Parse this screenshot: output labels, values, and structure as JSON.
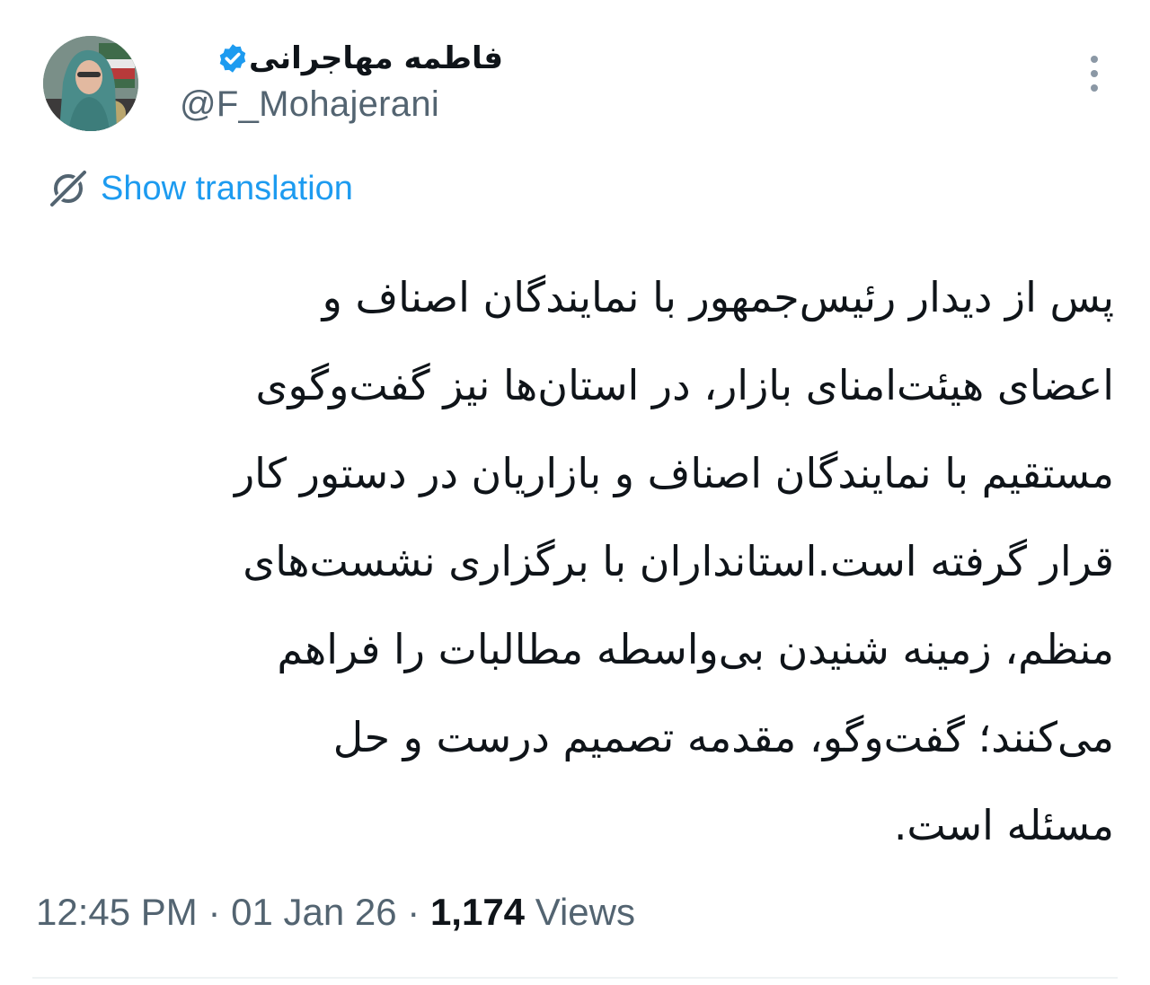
{
  "author": {
    "display_name": "فاطمه مهاجرانی",
    "handle": "@F_Mohajerani",
    "verified": true,
    "avatar_icon": "profile-photo"
  },
  "translate": {
    "label": "Show translation",
    "icon": "translate-icon"
  },
  "tweet": {
    "lines": [
      "پس از دیدار رئیس‌جمهور با نمایندگان اصناف و",
      "اعضای هیئت‌امنای بازار، در استان‌ها نیز گفت‌وگوی",
      "مستقیم با نمایندگان اصناف و بازاریان در دستور کار",
      "قرار گرفته است.استانداران با برگزاری نشست‌های",
      "منظم، زمینه شنیدن بی‌واسطه مطالبات را فراهم",
      "می‌کنند؛ گفت‌وگو، مقدمه تصمیم درست و حل",
      "مسئله است."
    ]
  },
  "meta": {
    "time": "12:45 PM",
    "separator": " · ",
    "date": "01 Jan 26",
    "views_count": "1,174",
    "views_label": " Views"
  },
  "colors": {
    "accent": "#1d9bf0",
    "text": "#0f1419",
    "secondary": "#536471"
  }
}
